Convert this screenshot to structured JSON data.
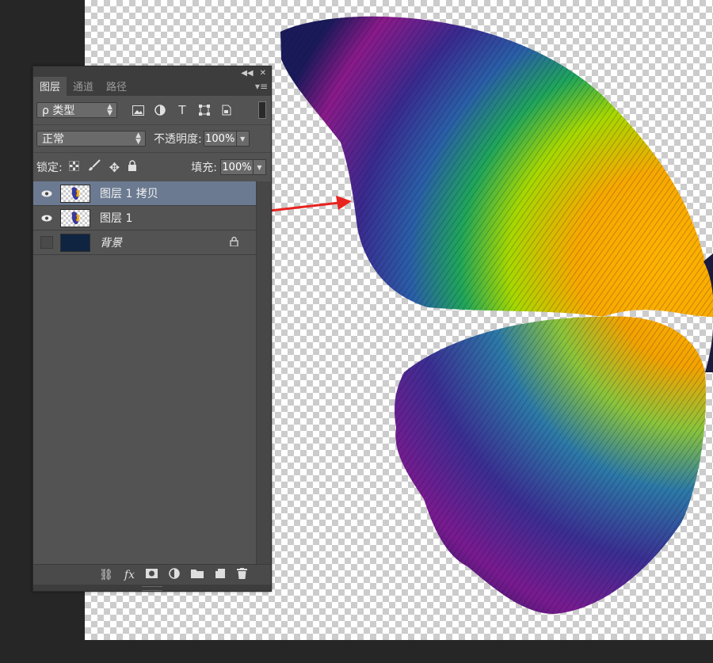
{
  "panel": {
    "collapse_icon": "collapse-arrows-icon",
    "close_icon": "close-icon",
    "tabs": [
      {
        "label": "图层",
        "active": true
      },
      {
        "label": "通道",
        "active": false
      },
      {
        "label": "路径",
        "active": false
      }
    ],
    "filter": {
      "kind_label": "ρ 类型",
      "icons": [
        "image-filter-icon",
        "adjustment-filter-icon",
        "type-filter-icon",
        "shape-filter-icon",
        "smart-object-filter-icon"
      ]
    },
    "blend": {
      "mode": "正常",
      "opacity_label": "不透明度:",
      "opacity_value": "100%"
    },
    "lock": {
      "label": "锁定:",
      "fill_label": "填充:",
      "fill_value": "100%"
    },
    "layers": [
      {
        "name": "图层 1 拷贝",
        "visible": true,
        "selected": true,
        "thumbnail": "butterfly"
      },
      {
        "name": "图层 1",
        "visible": true,
        "selected": false,
        "thumbnail": "butterfly"
      },
      {
        "name": "背景",
        "visible": false,
        "selected": false,
        "locked": true,
        "thumbnail": "navy"
      }
    ],
    "bottom_icons": [
      "link-layers-icon",
      "fx-icon",
      "mask-icon",
      "adjustment-layer-icon",
      "group-folder-icon",
      "new-layer-icon",
      "trash-icon"
    ]
  },
  "colors": {
    "arrow": "#e8231f",
    "selected_layer": "#6b7a91",
    "panel_bg": "#535353",
    "background_layer": "#0e2440"
  }
}
